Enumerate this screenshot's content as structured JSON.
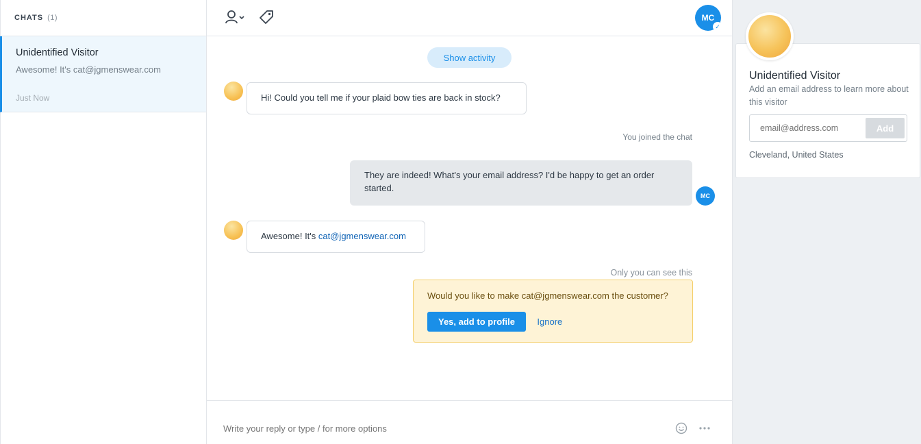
{
  "sidebar": {
    "header_label": "CHATS",
    "header_count": "(1)",
    "chats": [
      {
        "name": "Unidentified Visitor",
        "preview": "Awesome! It's cat@jgmenswear.com",
        "time": "Just Now"
      }
    ]
  },
  "toolbar": {
    "assign_icon": "user-chevron-icon",
    "tag_icon": "tag-icon",
    "agent_initials": "MC"
  },
  "conversation": {
    "show_activity_label": "Show activity",
    "messages": [
      {
        "from": "visitor",
        "text": "Hi! Could you tell me if your plaid bow ties are back in stock?"
      },
      {
        "from": "system",
        "text": "You joined the chat"
      },
      {
        "from": "agent",
        "text": "They are indeed! What's your email address? I'd be happy to get an order started.",
        "initials": "MC"
      },
      {
        "from": "visitor",
        "text_prefix": "Awesome! It's ",
        "link": "cat@jgmenswear.com"
      }
    ],
    "private_label": "Only you can see this",
    "note": {
      "question": "Would you like to make cat@jgmenswear.com the customer?",
      "primary_label": "Yes, add to profile",
      "secondary_label": "Ignore"
    }
  },
  "composer": {
    "placeholder": "Write your reply or type / for more options",
    "emoji_icon": "smiley-icon",
    "more_icon": "ellipsis-icon"
  },
  "profile": {
    "name": "Unidentified Visitor",
    "hint": "Add an email address to learn more about this visitor",
    "email_placeholder": "email@address.com",
    "add_label": "Add",
    "location": "Cleveland, United States"
  },
  "colors": {
    "accent": "#1a8fe8",
    "note_bg": "#fef3d6",
    "note_border": "#f4cf6a"
  }
}
